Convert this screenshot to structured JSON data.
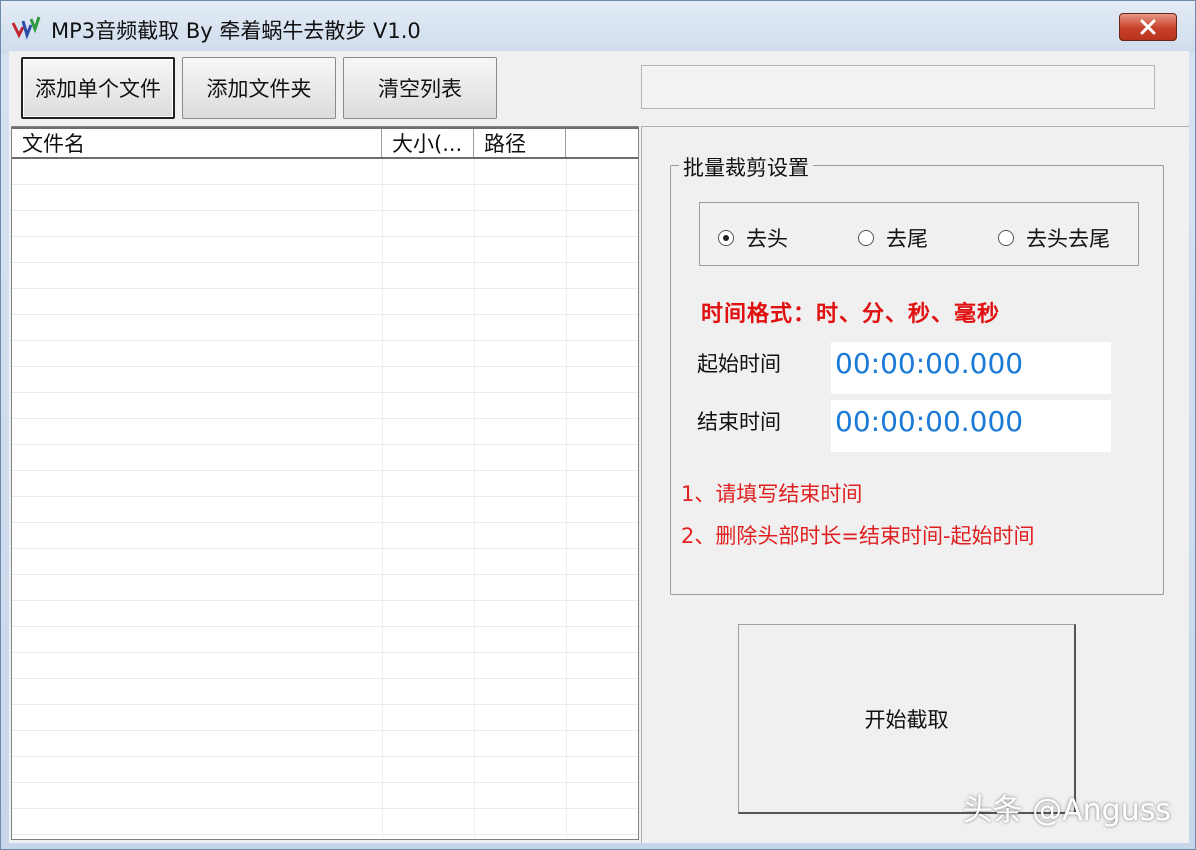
{
  "window": {
    "title": "MP3音频截取 By 牵着蜗牛去散步 V1.0",
    "icon": "app-logo-icon",
    "close_icon": "close-icon"
  },
  "toolbar": {
    "add_file_label": "添加单个文件",
    "add_folder_label": "添加文件夹",
    "clear_list_label": "清空列表"
  },
  "status_box": {
    "value": ""
  },
  "file_list": {
    "columns": [
      {
        "label": "文件名"
      },
      {
        "label": "大小(..."
      },
      {
        "label": "路径"
      }
    ],
    "rows": []
  },
  "settings": {
    "group_title": "批量裁剪设置",
    "modes": [
      {
        "label": "去头",
        "selected": true
      },
      {
        "label": "去尾",
        "selected": false
      },
      {
        "label": "去头去尾",
        "selected": false
      }
    ],
    "format_label": "时间格式：时、分、秒、毫秒",
    "start_time_label": "起始时间",
    "start_time_value": "00:00:00.000",
    "end_time_label": "结束时间",
    "end_time_value": "00:00:00.000",
    "note1": "1、请填写结束时间",
    "note2": "2、删除头部时长=结束时间-起始时间"
  },
  "start_button_label": "开始截取",
  "watermark": "头条 @Anguss",
  "colors": {
    "accent_red": "#e01010",
    "time_blue": "#1a7ad6"
  }
}
